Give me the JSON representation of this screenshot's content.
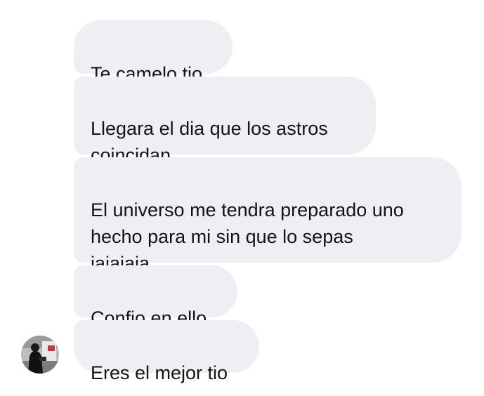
{
  "conversation": {
    "messages": [
      {
        "text": "Te camelo tio"
      },
      {
        "text": "Llegara el dia que los astros\ncoincidan"
      },
      {
        "text": "El universo me tendra preparado uno\nhecho para mi sin que lo sepas\njajajaja"
      },
      {
        "text": "Confio en ello"
      },
      {
        "text": "Eres el mejor tio"
      }
    ]
  },
  "contact": {
    "avatar_icon": "contact-avatar-photo"
  },
  "colors": {
    "bubble_background": "#eeeef3",
    "text": "#141414",
    "page_background": "#ffffff"
  }
}
